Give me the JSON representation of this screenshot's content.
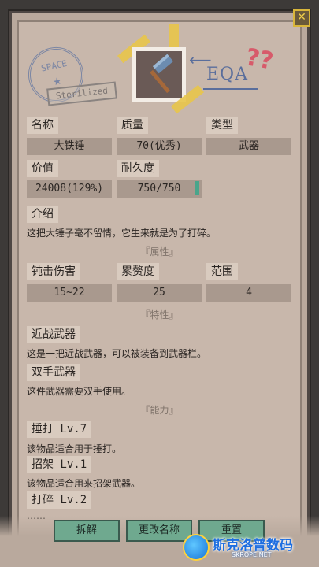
{
  "item": {
    "stamp_text": "SPACE",
    "sterilized": "Sterilized",
    "annotation": "EQA",
    "qmarks": "??",
    "fields": {
      "name_label": "名称",
      "name_value": "大铁锤",
      "quality_label": "质量",
      "quality_value": "70(优秀)",
      "type_label": "类型",
      "type_value": "武器",
      "price_label": "价值",
      "price_value": "24008(129%)",
      "durability_label": "耐久度",
      "durability_value": "750/750",
      "durability_fraction": 1.0
    },
    "intro_label": "介绍",
    "intro_text": "这把大锤子毫不留情，它生来就是为了打碎。",
    "attributes_header": "『属性』",
    "attributes": {
      "blunt_label": "钝击伤害",
      "blunt_value": "15~22",
      "fatigue_label": "累赘度",
      "fatigue_value": "25",
      "range_label": "范围",
      "range_value": "4"
    },
    "traits_header": "『特性』",
    "traits": [
      {
        "label": "近战武器",
        "desc": "这是一把近战武器，可以被装备到武器栏。"
      },
      {
        "label": "双手武器",
        "desc": "这件武器需要双手使用。"
      }
    ],
    "abilities_header": "『能力』",
    "abilities": [
      {
        "label": "捶打 Lv.7",
        "desc": "该物品适合用于捶打。"
      },
      {
        "label": "招架 Lv.1",
        "desc": "该物品适合用来招架武器。"
      },
      {
        "label": "打碎 Lv.2",
        "desc": "……"
      }
    ]
  },
  "buttons": {
    "close": "✕",
    "dismantle": "拆解",
    "rename": "更改名称",
    "reforge": "重置"
  },
  "watermark": {
    "text": "斯克洛普数码",
    "sub": "SKROPE.NET"
  }
}
